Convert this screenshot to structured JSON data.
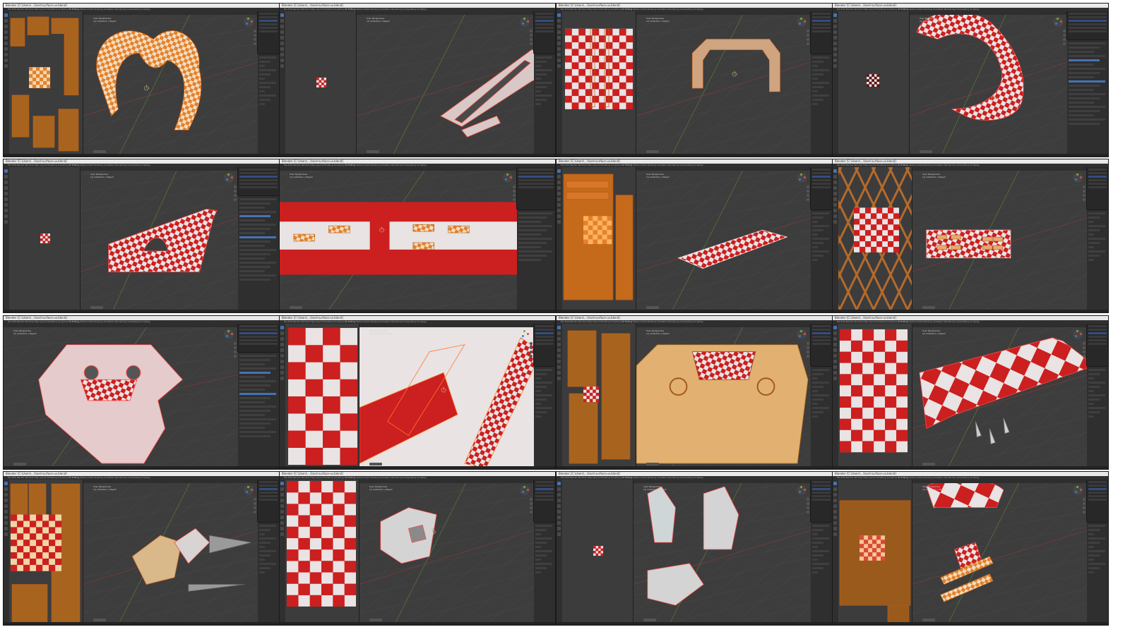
{
  "app": {
    "window_title": "Blender [C:\\Users\\...\\hard-surface-uv.blend]",
    "menu": [
      "File",
      "Edit",
      "Render",
      "Window",
      "Help"
    ],
    "workspaces": [
      "Layout",
      "Modeling",
      "Sculpting",
      "UV Editing",
      "Texture Paint",
      "Shading",
      "Animation",
      "Rendering",
      "Compositing",
      "Scripting"
    ],
    "active_workspace": "UV Editing",
    "viewport_overlay": [
      "User Perspective",
      "(1) Collection | Object"
    ]
  },
  "colors": {
    "checker_red": "#cc1f1f",
    "checker_white": "#e9e3e3",
    "uv_orange": "#e4812b",
    "uv_edge": "#b85a14",
    "selection_blue": "#4772b3",
    "viewport_bg": "#3d3d3d",
    "uv_bg": "#3c3c3c"
  },
  "icons": [
    "navigation-gizmo-icon",
    "cursor-3d-icon",
    "origin-dot-icon",
    "move-tool-icon",
    "zoom-icon",
    "camera-icon"
  ],
  "frames": [
    {
      "id": "f1",
      "uv": "orange-islands",
      "scene": "ring-orange"
    },
    {
      "id": "f2",
      "uv": "tiny-checker",
      "scene": "bracket-pink"
    },
    {
      "id": "f3",
      "uv": "checker-tall",
      "scene": "arch-tan"
    },
    {
      "id": "f4",
      "uv": "tiny-checker-dark",
      "scene": "ring-red",
      "props": "full"
    },
    {
      "id": "f5",
      "uv": "tiny-checker",
      "scene": "panel-red",
      "props": "full"
    },
    {
      "id": "f6",
      "uv": "none",
      "scene": "plate-closeup",
      "props": "dark"
    },
    {
      "id": "f7",
      "uv": "orange-stack",
      "scene": "plate-striped"
    },
    {
      "id": "f8",
      "uv": "diamond-mesh",
      "scene": "plate-pink"
    },
    {
      "id": "f9",
      "uv": "none",
      "scene": "chest-pink",
      "props": "full"
    },
    {
      "id": "f10",
      "uv": "checker-big",
      "scene": "closeup-red"
    },
    {
      "id": "f11",
      "uv": "orange-pieces",
      "scene": "chest-orange"
    },
    {
      "id": "f12",
      "uv": "checker-big2",
      "scene": "wedge-red"
    },
    {
      "id": "f13",
      "uv": "orange-checker",
      "scene": "limb-tan"
    },
    {
      "id": "f14",
      "uv": "checker-column",
      "scene": "limb-grey"
    },
    {
      "id": "f15",
      "uv": "tiny-checker",
      "scene": "parts-grey"
    },
    {
      "id": "f16",
      "uv": "orange-blocks",
      "scene": "parts-red"
    }
  ]
}
